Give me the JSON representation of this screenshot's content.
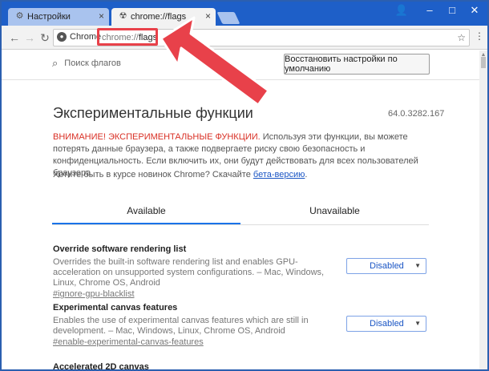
{
  "tabs": [
    {
      "label": "Настройки",
      "icon": "gear-icon"
    },
    {
      "label": "chrome://flags",
      "icon": "radiation-icon"
    }
  ],
  "toolbar": {
    "chip_label": "Chrome",
    "url_prefix": "chrome://",
    "url_path": "flags"
  },
  "page": {
    "search_placeholder": "Поиск флагов",
    "reset_label": "Восстановить настройки по умолчанию",
    "title": "Экспериментальные функции",
    "version": "64.0.3282.167",
    "warning_label": "ВНИМАНИЕ! ЭКСПЕРИМЕНТАЛЬНЫЕ ФУНКЦИИ.",
    "warning_text": " Используя эти функции, вы можете потерять данные браузера, а также подвергаете риску свою безопасность и конфиденциальность. Если включить их, они будут действовать для всех пользователей браузера.",
    "beta_text": "Хотите быть в курсе новинок Chrome? Скачайте ",
    "beta_link": "бета-версию",
    "beta_end": "."
  },
  "view_tabs": {
    "available": "Available",
    "unavailable": "Unavailable"
  },
  "flags": [
    {
      "title": "Override software rendering list",
      "description": "Overrides the built-in software rendering list and enables GPU-acceleration on unsupported system configurations. – Mac, Windows, Linux, Chrome OS, Android",
      "link": "#ignore-gpu-blacklist",
      "value": "Disabled"
    },
    {
      "title": "Experimental canvas features",
      "description": "Enables the use of experimental canvas features which are still in development. – Mac, Windows, Linux, Chrome OS, Android",
      "link": "#enable-experimental-canvas-features",
      "value": "Disabled"
    },
    {
      "title": "Accelerated 2D canvas",
      "description": "",
      "link": "",
      "value": ""
    }
  ],
  "colors": {
    "accent": "#1a73e8",
    "warning": "#d93025",
    "highlight": "#e8414a",
    "titlebar": "#1e5fc8"
  }
}
